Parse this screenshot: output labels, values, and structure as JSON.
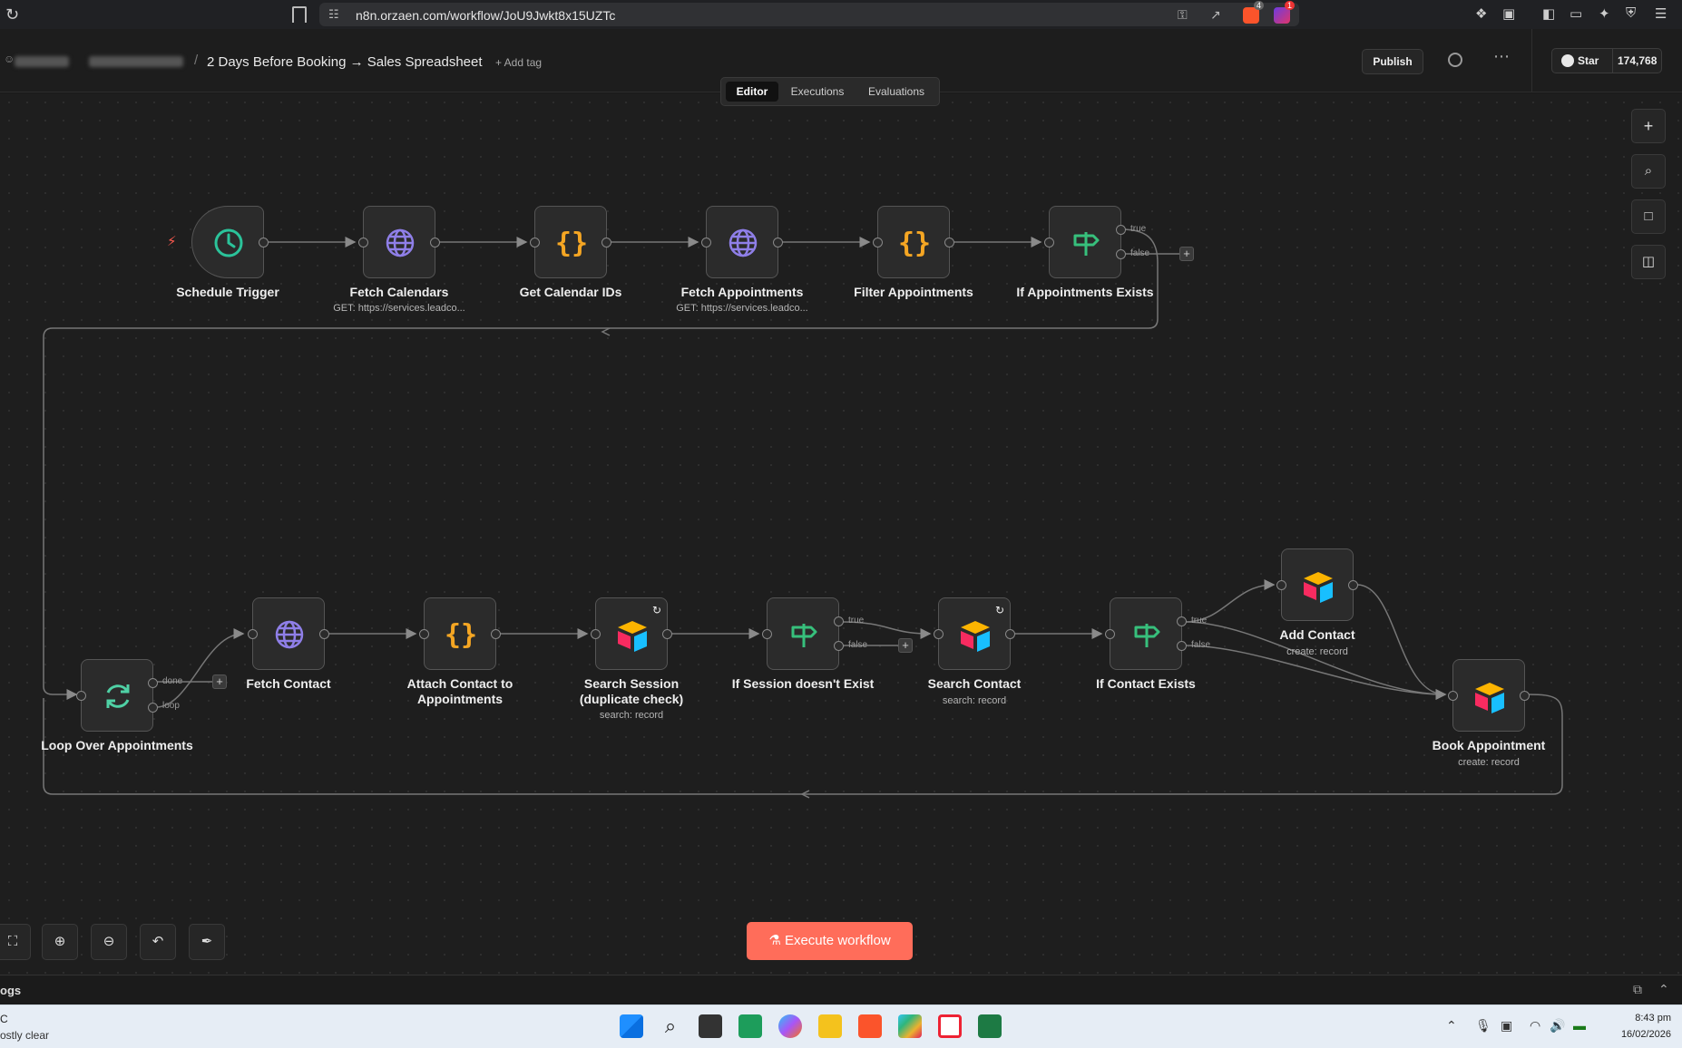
{
  "browser": {
    "url": "n8n.orzaen.com/workflow/JoU9Jwkt8x15UZTc",
    "badges": [
      "4",
      "1"
    ]
  },
  "header": {
    "workflow_title": "2 Days Before Booking → Sales Spreadsheet",
    "add_tag": "+ Add tag",
    "publish": "Publish",
    "github_star": "Star",
    "github_count": "174,768"
  },
  "tabs": [
    "Editor",
    "Executions",
    "Evaluations"
  ],
  "nodes": {
    "schedule_trigger": {
      "label": "Schedule Trigger",
      "icon": "clock-icon"
    },
    "fetch_calendars": {
      "label": "Fetch Calendars",
      "sub": "GET: https://services.leadco...",
      "icon": "globe-icon"
    },
    "get_calendar_ids": {
      "label": "Get Calendar IDs",
      "icon": "code-braces-icon"
    },
    "fetch_appointments": {
      "label": "Fetch Appointments",
      "sub": "GET: https://services.leadco...",
      "icon": "globe-icon"
    },
    "filter_appointments": {
      "label": "Filter Appointments",
      "icon": "code-braces-icon"
    },
    "if_appointments_exists": {
      "label": "If Appointments Exists",
      "icon": "signpost-icon"
    },
    "loop_over_appointments": {
      "label": "Loop Over Appointments",
      "icon": "loop-icon"
    },
    "fetch_contact": {
      "label": "Fetch Contact",
      "icon": "globe-icon"
    },
    "attach_contact": {
      "label": "Attach Contact to Appointments",
      "icon": "code-braces-icon"
    },
    "search_session": {
      "label": "Search Session (duplicate check)",
      "sub": "search: record",
      "icon": "airtable-icon"
    },
    "if_session_not_exist": {
      "label": "If Session doesn't Exist",
      "icon": "signpost-icon"
    },
    "search_contact": {
      "label": "Search Contact",
      "sub": "search: record",
      "icon": "airtable-icon"
    },
    "if_contact_exists": {
      "label": "If Contact Exists",
      "icon": "signpost-icon"
    },
    "add_contact": {
      "label": "Add Contact",
      "sub": "create: record",
      "icon": "airtable-icon"
    },
    "book_appointment": {
      "label": "Book Appointment",
      "sub": "create: record",
      "icon": "airtable-icon"
    }
  },
  "handle_labels": {
    "true": "true",
    "false": "false",
    "done": "done",
    "loop": "loop"
  },
  "execute_button": "Execute workflow",
  "logs": "ogs",
  "taskbar": {
    "weather_line1": "C",
    "weather_line2": "ostly clear",
    "time": "8:43 pm",
    "date": "16/02/2026"
  },
  "colors": {
    "accent": "#ff6d5a",
    "trigger_icon": "#2bc39a",
    "globe_icon": "#8f7fe8",
    "code_icon": "#f5a623",
    "if_icon": "#37c07c",
    "loop_icon": "#4fd1a5"
  }
}
